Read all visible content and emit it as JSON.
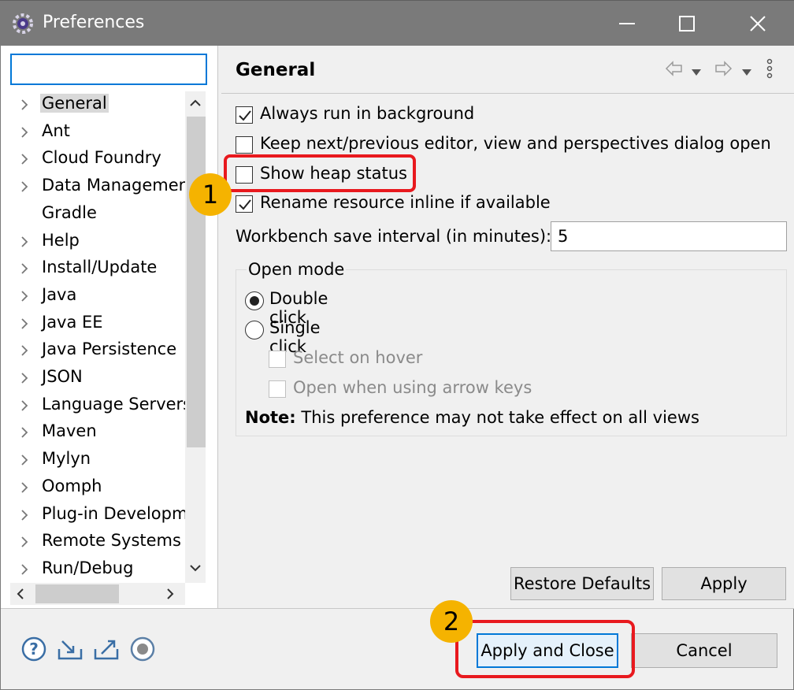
{
  "window": {
    "title": "Preferences",
    "icon": "eclipse-gear-icon"
  },
  "left": {
    "filter_value": "",
    "tree": [
      {
        "label": "General",
        "expandable": true,
        "selected": true
      },
      {
        "label": "Ant",
        "expandable": true
      },
      {
        "label": "Cloud Foundry",
        "expandable": true
      },
      {
        "label": "Data Managemen",
        "expandable": true
      },
      {
        "label": "Gradle",
        "expandable": false
      },
      {
        "label": "Help",
        "expandable": true
      },
      {
        "label": "Install/Update",
        "expandable": true
      },
      {
        "label": "Java",
        "expandable": true
      },
      {
        "label": "Java EE",
        "expandable": true
      },
      {
        "label": "Java Persistence",
        "expandable": true
      },
      {
        "label": "JSON",
        "expandable": true
      },
      {
        "label": "Language Servers",
        "expandable": true
      },
      {
        "label": "Maven",
        "expandable": true
      },
      {
        "label": "Mylyn",
        "expandable": true
      },
      {
        "label": "Oomph",
        "expandable": true
      },
      {
        "label": "Plug-in Developm",
        "expandable": true
      },
      {
        "label": "Remote Systems",
        "expandable": true
      },
      {
        "label": "Run/Debug",
        "expandable": true
      }
    ]
  },
  "page": {
    "title": "General",
    "options": [
      {
        "label": "Always run in background",
        "checked": true
      },
      {
        "label": "Keep next/previous editor, view and perspectives dialog open",
        "checked": false
      },
      {
        "label": "Show heap status",
        "checked": false
      },
      {
        "label": "Rename resource inline if available",
        "checked": true
      }
    ],
    "save_interval_label": "Workbench save interval (in minutes):",
    "save_interval_value": "5",
    "open_mode": {
      "title": "Open mode",
      "double_click": "Double click",
      "single_click": "Single click",
      "selected": "double",
      "select_on_hover": "Select on hover",
      "open_arrow_keys": "Open when using arrow keys",
      "note_bold": "Note:",
      "note_text": " This preference may not take effect on all views"
    },
    "restore_defaults": "Restore Defaults",
    "apply": "Apply"
  },
  "footer": {
    "icons": [
      "help-icon",
      "import-icon",
      "export-icon",
      "record-icon"
    ],
    "apply_close": "Apply and Close",
    "cancel": "Cancel"
  },
  "annotations": {
    "badge1": "1",
    "badge2": "2",
    "color": "#e8191e",
    "badge_color": "#f5b300"
  }
}
